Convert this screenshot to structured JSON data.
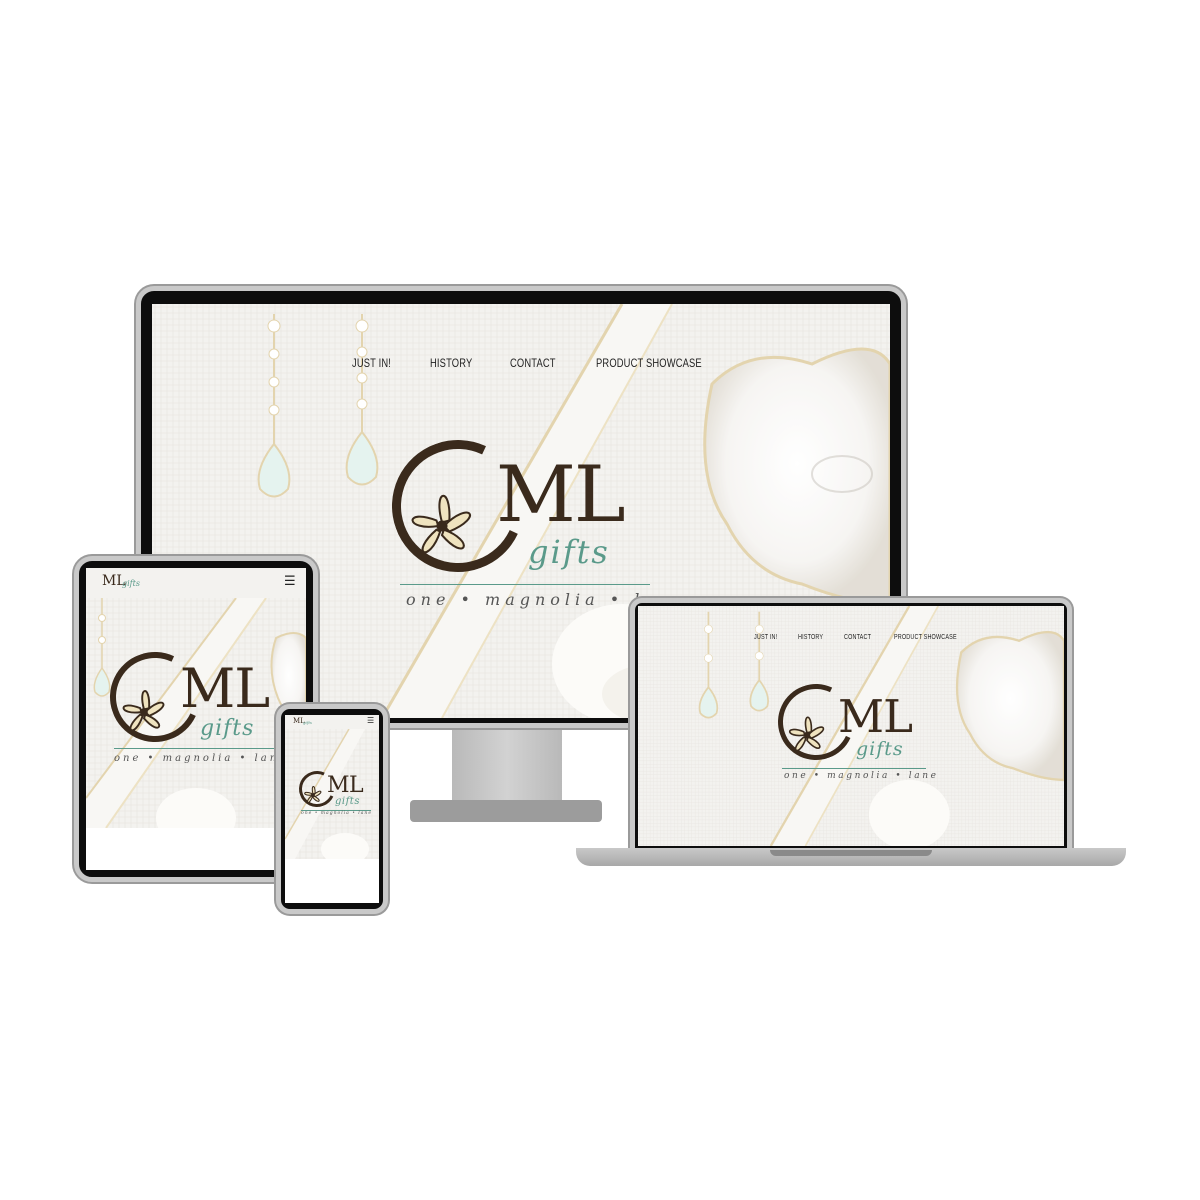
{
  "site": {
    "nav": [
      "JUST IN!",
      "HISTORY",
      "CONTACT",
      "PRODUCT SHOWCASE"
    ],
    "logo": {
      "monogram": "ML",
      "script": "gifts",
      "tagline": "one • magnolia • lane"
    },
    "mobile_menu_icon": "menu-icon"
  },
  "devices": [
    "desktop-monitor",
    "laptop",
    "tablet",
    "phone"
  ],
  "colors": {
    "logo_brown": "#3a2a1c",
    "logo_teal": "#5a9a8a",
    "flower_cream": "#efe3bf",
    "bezel_black": "#0d0d0d",
    "device_silver": "#c9c9c9",
    "linen_bg": "#eeece8",
    "gold_accent": "#d9c48f"
  }
}
